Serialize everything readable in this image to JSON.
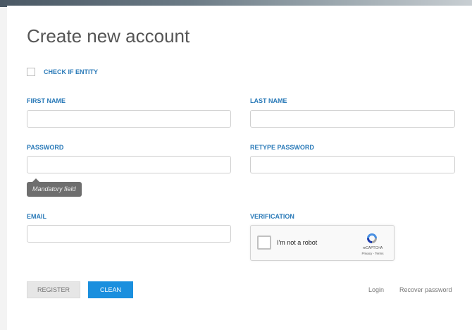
{
  "page": {
    "title": "Create new account"
  },
  "entity": {
    "label": "CHECK IF ENTITY",
    "checked": false
  },
  "fields": {
    "first_name": {
      "label": "FIRST NAME",
      "value": "",
      "placeholder": ""
    },
    "last_name": {
      "label": "LAST NAME",
      "value": "",
      "placeholder": ""
    },
    "password": {
      "label": "PASSWORD",
      "value": "",
      "placeholder": ""
    },
    "retype_password": {
      "label": "RETYPE PASSWORD",
      "value": "",
      "placeholder": ""
    },
    "email": {
      "label": "EMAIL",
      "value": "",
      "placeholder": ""
    }
  },
  "tooltip": {
    "text": "Mandatory field"
  },
  "verification": {
    "label": "VERIFICATION",
    "robot_text": "I'm not a robot",
    "brand": "reCAPTCHA",
    "terms": "Privacy - Terms"
  },
  "actions": {
    "register_label": "REGISTER",
    "clean_label": "CLEAN",
    "login_link": "Login",
    "recover_link": "Recover password"
  },
  "colors": {
    "label_blue": "#2a7ab8",
    "primary_button": "#1a8fde",
    "secondary_button": "#e6e6e6",
    "tooltip_bg": "#6e6e6e"
  },
  "icons": {
    "captcha": "recaptcha-logo-icon",
    "tooltip_pointer": "tooltip-arrow-icon"
  }
}
